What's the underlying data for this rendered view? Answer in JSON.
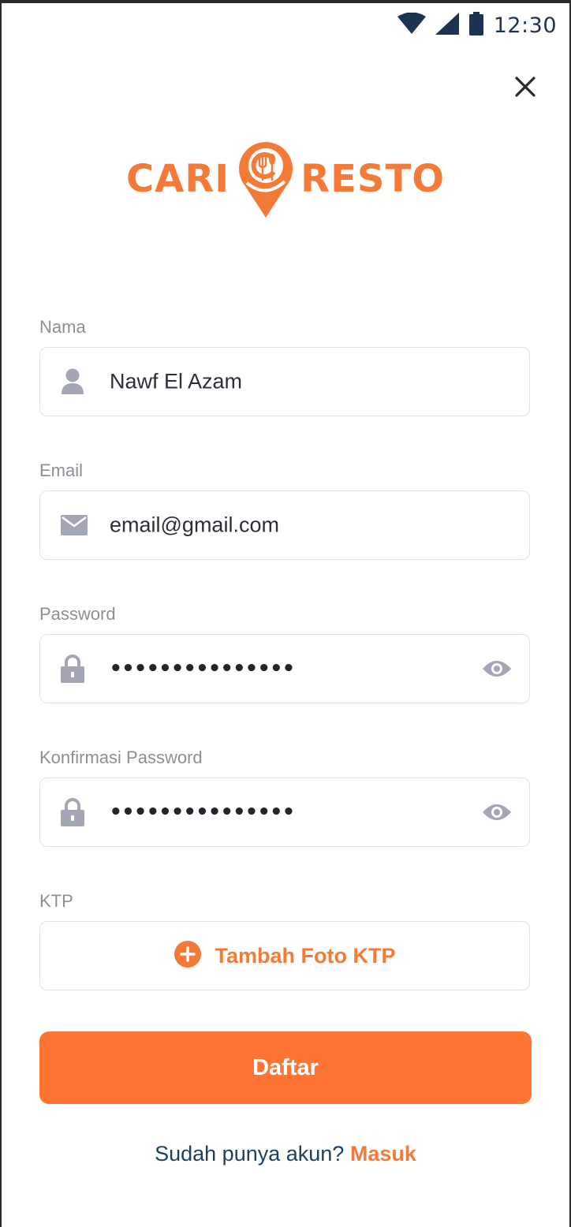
{
  "status_bar": {
    "time": "12:30"
  },
  "logo": {
    "left_word": "CARI",
    "right_word": "RESTO"
  },
  "form": {
    "name": {
      "label": "Nama",
      "value": "Nawf El Azam"
    },
    "email": {
      "label": "Email",
      "value": "email@gmail.com"
    },
    "password": {
      "label": "Password",
      "value": "•••••••••••••••"
    },
    "confirm_password": {
      "label": "Konfirmasi Password",
      "value": "•••••••••••••••"
    },
    "ktp": {
      "label": "KTP",
      "action_label": "Tambah Foto KTP"
    },
    "submit_label": "Daftar"
  },
  "footer": {
    "question": "Sudah punya akun?",
    "link": "Masuk"
  },
  "colors": {
    "accent": "#ff7433",
    "icon_gray": "#a3a6b4",
    "link_navy": "#1f3f5e"
  },
  "icons": [
    "wifi-icon",
    "signal-icon",
    "battery-icon",
    "close-icon",
    "user-icon",
    "mail-icon",
    "lock-icon",
    "eye-icon",
    "plus-circle-icon",
    "fork-spoon-pin-icon"
  ]
}
